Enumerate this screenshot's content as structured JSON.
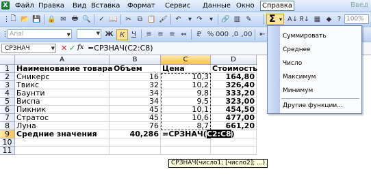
{
  "menu": {
    "items": [
      "Файл",
      "Правка",
      "Вид",
      "Вставка",
      "Формат",
      "Сервис",
      "Данные",
      "Окно",
      "Справка"
    ],
    "help_hint": "Введ"
  },
  "toolbar": {
    "font_name": "Arial",
    "zoom": "100%"
  },
  "formula_bar": {
    "name_box": "СРЗНАЧ",
    "formula": "=СРЗНАЧ(C2:C8)"
  },
  "columns": [
    "A",
    "B",
    "C",
    "D"
  ],
  "rows": [
    "1",
    "2",
    "3",
    "4",
    "5",
    "6",
    "7",
    "8",
    "9",
    "10",
    "11"
  ],
  "table": {
    "headers": [
      "Наименование товара",
      "Объем",
      "Цена",
      "Стоимость"
    ],
    "data": [
      {
        "name": "Сникерс",
        "volume": "16",
        "price": "10,3",
        "cost": "164,80"
      },
      {
        "name": "Твикс",
        "volume": "32",
        "price": "10,2",
        "cost": "326,40"
      },
      {
        "name": "Баунти",
        "volume": "34",
        "price": "9,8",
        "cost": "333,20"
      },
      {
        "name": "Виспа",
        "volume": "34",
        "price": "9,5",
        "cost": "323,00"
      },
      {
        "name": "Пикник",
        "volume": "45",
        "price": "10,1",
        "cost": "454,50"
      },
      {
        "name": "Стратос",
        "volume": "45",
        "price": "10,6",
        "cost": "477,00"
      },
      {
        "name": "Луна",
        "volume": "76",
        "price": "8,7",
        "cost": "661,20"
      }
    ],
    "average_label": "Средние значения",
    "average_volume": "40,286",
    "edit_prefix": "=СРЗНАЧ(",
    "edit_range": "C2:C8",
    "edit_suffix": ")"
  },
  "tooltip": "СРЗНАЧ(число1; [число2]; ...)",
  "autosum_menu": {
    "items": [
      "Суммировать",
      "Среднее",
      "Число",
      "Максимум",
      "Минимум"
    ],
    "more": "Другие функции..."
  },
  "colors": {
    "accent": "#f6c253",
    "menu_border": "#6a86b8"
  }
}
